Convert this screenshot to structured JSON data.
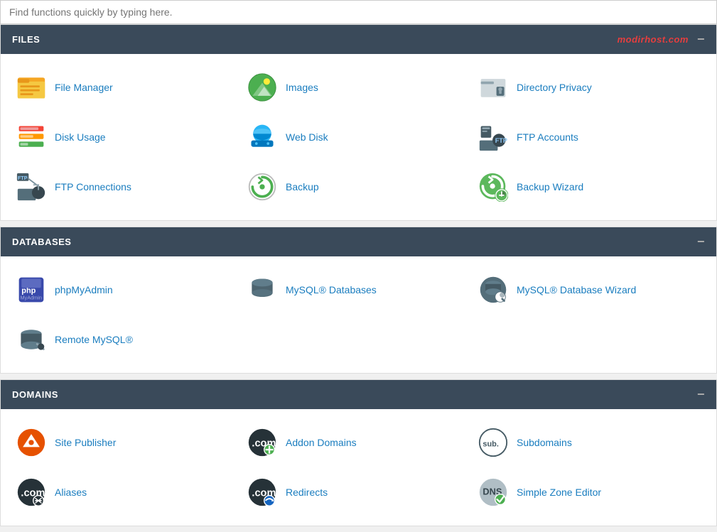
{
  "search": {
    "placeholder": "Find functions quickly by typing here."
  },
  "sections": [
    {
      "id": "files",
      "label": "FILES",
      "brand": "modirhost.com",
      "items": [
        {
          "id": "file-manager",
          "label": "File Manager",
          "icon": "file-manager"
        },
        {
          "id": "images",
          "label": "Images",
          "icon": "images"
        },
        {
          "id": "directory-privacy",
          "label": "Directory Privacy",
          "icon": "directory-privacy"
        },
        {
          "id": "disk-usage",
          "label": "Disk Usage",
          "icon": "disk-usage"
        },
        {
          "id": "web-disk",
          "label": "Web Disk",
          "icon": "web-disk"
        },
        {
          "id": "ftp-accounts",
          "label": "FTP Accounts",
          "icon": "ftp-accounts"
        },
        {
          "id": "ftp-connections",
          "label": "FTP Connections",
          "icon": "ftp-connections"
        },
        {
          "id": "backup",
          "label": "Backup",
          "icon": "backup"
        },
        {
          "id": "backup-wizard",
          "label": "Backup Wizard",
          "icon": "backup-wizard"
        }
      ]
    },
    {
      "id": "databases",
      "label": "DATABASES",
      "brand": "",
      "items": [
        {
          "id": "phpmyadmin",
          "label": "phpMyAdmin",
          "icon": "phpmyadmin"
        },
        {
          "id": "mysql-databases",
          "label": "MySQL® Databases",
          "icon": "mysql-databases"
        },
        {
          "id": "mysql-database-wizard",
          "label": "MySQL® Database Wizard",
          "icon": "mysql-database-wizard"
        },
        {
          "id": "remote-mysql",
          "label": "Remote MySQL®",
          "icon": "remote-mysql"
        }
      ]
    },
    {
      "id": "domains",
      "label": "DOMAINS",
      "brand": "",
      "items": [
        {
          "id": "site-publisher",
          "label": "Site Publisher",
          "icon": "site-publisher"
        },
        {
          "id": "addon-domains",
          "label": "Addon Domains",
          "icon": "addon-domains"
        },
        {
          "id": "subdomains",
          "label": "Subdomains",
          "icon": "subdomains"
        },
        {
          "id": "aliases",
          "label": "Aliases",
          "icon": "aliases"
        },
        {
          "id": "redirects",
          "label": "Redirects",
          "icon": "redirects"
        },
        {
          "id": "simple-zone-editor",
          "label": "Simple Zone Editor",
          "icon": "simple-zone-editor"
        }
      ]
    }
  ]
}
